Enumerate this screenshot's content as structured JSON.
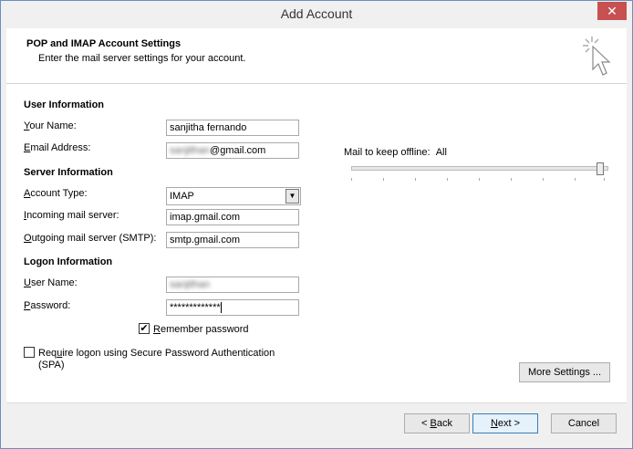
{
  "window": {
    "title": "Add Account",
    "close_glyph": "✕"
  },
  "header": {
    "title": "POP and IMAP Account Settings",
    "subtitle": "Enter the mail server settings for your account.",
    "icon": "wizard-cursor-icon"
  },
  "user_info": {
    "heading": "User Information",
    "your_name": {
      "label_accel": "Y",
      "label_rest": "our Name:",
      "value": "sanjitha fernando"
    },
    "email": {
      "label_accel": "E",
      "label_rest": "mail Address:",
      "value_hidden": "sanjithan",
      "value_suffix": "@gmail.com"
    }
  },
  "server_info": {
    "heading": "Server Information",
    "account_type": {
      "label_accel": "A",
      "label_rest": "ccount Type:",
      "value": "IMAP"
    },
    "incoming": {
      "label_accel": "I",
      "label_rest": "ncoming mail server:",
      "value": "imap.gmail.com"
    },
    "outgoing": {
      "label_accel": "O",
      "label_rest": "utgoing mail server (SMTP):",
      "value": "smtp.gmail.com"
    }
  },
  "logon_info": {
    "heading": "Logon Information",
    "user_name": {
      "label_accel": "U",
      "label_rest": "ser Name:",
      "value_hidden": "sanjithan"
    },
    "password": {
      "label_accel": "P",
      "label_rest": "assword:",
      "value": "*************"
    },
    "remember": {
      "label_accel": "R",
      "label_rest": "emember password",
      "checked": true,
      "check_glyph": "✔"
    },
    "spa": {
      "label_pre": "Req",
      "label_accel": "u",
      "label_rest": "ire logon using Secure Password Authentication",
      "label_line2": "(SPA)",
      "checked": false
    }
  },
  "offline": {
    "label": "Mail to keep offline:",
    "value": "All",
    "level": 1.0
  },
  "buttons": {
    "more_settings": "More Settings ...",
    "back": {
      "pre": "< ",
      "accel": "B",
      "rest": "ack"
    },
    "next": {
      "accel": "N",
      "rest": "ext >"
    },
    "cancel": "Cancel"
  }
}
